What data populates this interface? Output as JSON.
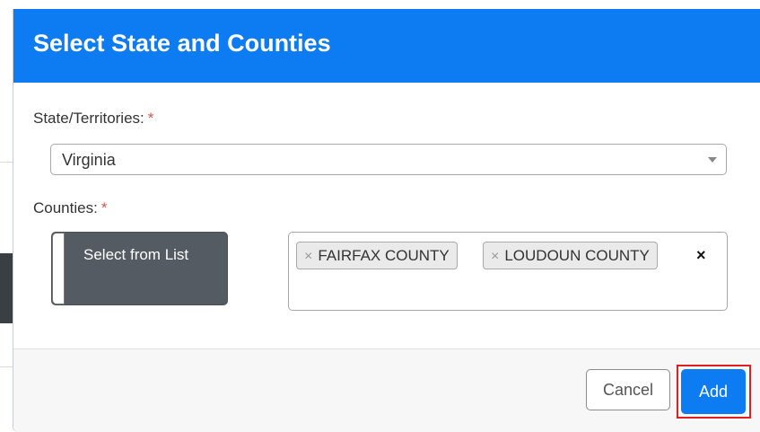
{
  "dialog": {
    "title": "Select State and Counties"
  },
  "state": {
    "label": "State/Territories:",
    "required_mark": "*",
    "selected_value": "Virginia"
  },
  "counties": {
    "label": "Counties:",
    "required_mark": "*",
    "select_list_button": "Select from List",
    "tag_remove_glyph": "×",
    "selected": [
      {
        "name": "FAIRFAX COUNTY"
      },
      {
        "name": "LOUDOUN COUNTY"
      }
    ],
    "clear_all_glyph": "×"
  },
  "footer": {
    "cancel_label": "Cancel",
    "add_label": "Add"
  },
  "colors": {
    "header_blue": "#0d7bf2",
    "list_button_gray": "#555b62",
    "required_red": "#d9534f",
    "highlight_red": "#e02020"
  },
  "icons": {
    "select_caret": "chevron-down-icon",
    "tag_remove": "close-icon",
    "clear_all": "close-icon"
  }
}
